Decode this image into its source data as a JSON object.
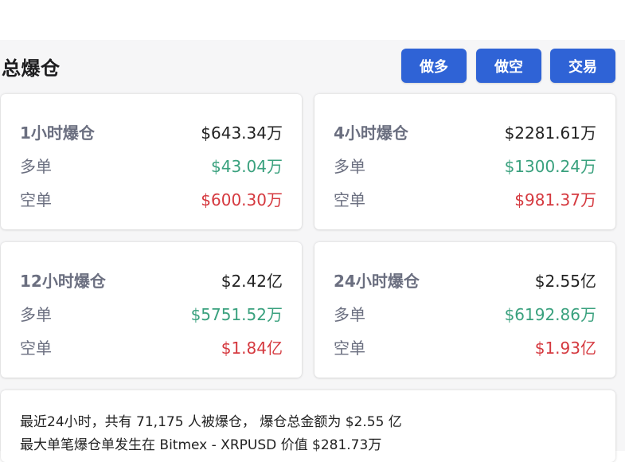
{
  "header": {
    "title": "总爆仓",
    "buttons": {
      "long": "做多",
      "short": "做空",
      "trade": "交易"
    }
  },
  "cards": [
    {
      "period_label": "1小时爆仓",
      "total": "$643.34万",
      "long_label": "多单",
      "long_value": "$43.04万",
      "short_label": "空单",
      "short_value": "$600.30万"
    },
    {
      "period_label": "4小时爆仓",
      "total": "$2281.61万",
      "long_label": "多单",
      "long_value": "$1300.24万",
      "short_label": "空单",
      "short_value": "$981.37万"
    },
    {
      "period_label": "12小时爆仓",
      "total": "$2.42亿",
      "long_label": "多单",
      "long_value": "$5751.52万",
      "short_label": "空单",
      "short_value": "$1.84亿"
    },
    {
      "period_label": "24小时爆仓",
      "total": "$2.55亿",
      "long_label": "多单",
      "long_value": "$6192.86万",
      "short_label": "空单",
      "short_value": "$1.93亿"
    }
  ],
  "summary": {
    "line1": "最近24小时，共有 71,175 人被爆仓， 爆仓总金额为 $2.55 亿",
    "line2": "最大单笔爆仓单发生在 Bitmex - XRPUSD 价值 $281.73万"
  },
  "colors": {
    "accent": "#2f63d6",
    "long": "#3aa17e",
    "short": "#d5393f"
  }
}
